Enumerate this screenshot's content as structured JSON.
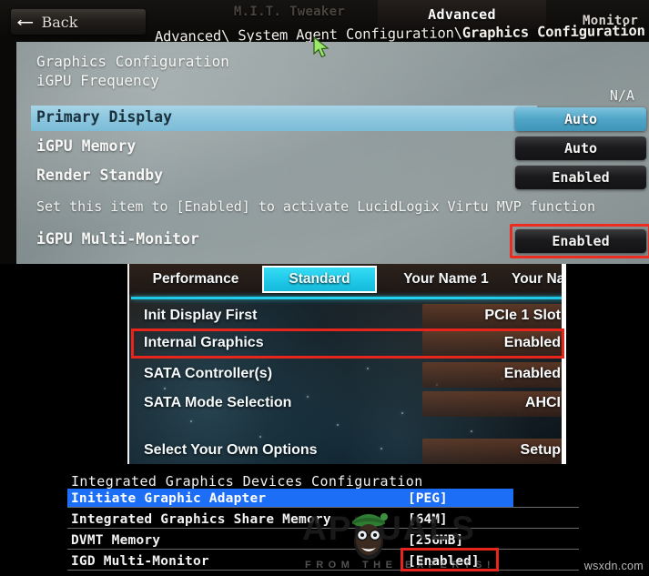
{
  "panel_top": {
    "nav_tabs": [
      {
        "label": "M.I.T. Tweaker",
        "active": false
      },
      {
        "label": "Advanced",
        "active": true
      },
      {
        "label": "Monitor",
        "active": false
      }
    ],
    "back_label": "Back",
    "back_icon": "left-arrow-icon",
    "breadcrumb": "Advanced\\ System Agent Configuration\\ Graphics Configuration",
    "breadcrumb_plain": "Advanced\\ System Agent Configuration\\",
    "breadcrumb_bold": "Graphics Configuration",
    "section_title": "Graphics Configuration",
    "frequency_label": "iGPU Frequency",
    "frequency_value": "N/A",
    "help_text": "Set this item to [Enabled] to activate LucidLogix Virtu MVP function",
    "rows": [
      {
        "label": "Primary Display",
        "value": "Auto",
        "selected": true,
        "highlighted": false
      },
      {
        "label": "iGPU Memory",
        "value": "Auto",
        "selected": false,
        "highlighted": false
      },
      {
        "label": "Render Standby",
        "value": "Enabled",
        "selected": false,
        "highlighted": false
      },
      {
        "label": "iGPU Multi-Monitor",
        "value": "Enabled",
        "selected": false,
        "highlighted": true
      }
    ],
    "highlight_color": "#ee2b20",
    "accent_color": "#4fa6c8"
  },
  "panel_middle": {
    "tabs": [
      {
        "label": "Performance",
        "active": false
      },
      {
        "label": "Standard",
        "active": true
      },
      {
        "label": "Your Name 1",
        "active": false
      },
      {
        "label": "Your Name",
        "active": false
      }
    ],
    "rows": [
      {
        "label": "Init Display First",
        "value": "PCIe 1 Slot",
        "highlighted": false
      },
      {
        "label": "Internal Graphics",
        "value": "Enabled",
        "highlighted": true
      },
      {
        "label": "SATA Controller(s)",
        "value": "Enabled",
        "highlighted": false
      },
      {
        "label": "SATA Mode Selection",
        "value": "AHCI",
        "highlighted": false
      },
      {
        "label": "Select Your Own Options",
        "value": "Setup",
        "highlighted": false
      }
    ],
    "highlight_color": "#e6261c",
    "accent_color": "#1ec8e6"
  },
  "panel_bottom": {
    "title": "Integrated Graphics Devices Configuration",
    "rows": [
      {
        "label": "Initiate Graphic Adapter",
        "value": "[PEG]",
        "selected": true,
        "highlighted": false
      },
      {
        "label": "Integrated Graphics Share Memory",
        "value": "[64M]",
        "selected": false,
        "highlighted": false
      },
      {
        "label": "DVMT Memory",
        "value": "[256MB]",
        "selected": false,
        "highlighted": false
      },
      {
        "label": "IGD Multi-Monitor",
        "value": "[Enabled]",
        "selected": false,
        "highlighted": true
      }
    ],
    "selection_color": "#1b6ef5",
    "highlight_color": "#e6261c"
  },
  "watermark": {
    "brand": "APPUALS",
    "tagline": "FROM THE EXPERTS!",
    "site": "wsxdn.com"
  }
}
